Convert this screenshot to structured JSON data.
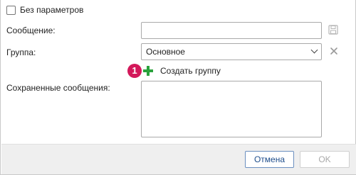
{
  "options": {
    "no_params_label": "Без параметров",
    "no_params_checked": false
  },
  "form": {
    "message_label": "Сообщение:",
    "message_value": "",
    "group_label": "Группа:",
    "group_selected": "Основное",
    "create_group_badge": "1",
    "create_group_label": "Создать группу",
    "saved_messages_label": "Сохраненные сообщения:",
    "saved_messages_value": ""
  },
  "icons": {
    "save": "save-icon",
    "clear": "close-icon",
    "add": "plus-icon",
    "dropdown": "chevron-down-icon"
  },
  "footer": {
    "cancel_label": "Отмена",
    "ok_label": "OK",
    "ok_enabled": false
  },
  "colors": {
    "badge": "#d3185a",
    "plus": "#2aa23c",
    "cancel_border": "#6b8fbf",
    "footer_bg": "#efefef"
  }
}
